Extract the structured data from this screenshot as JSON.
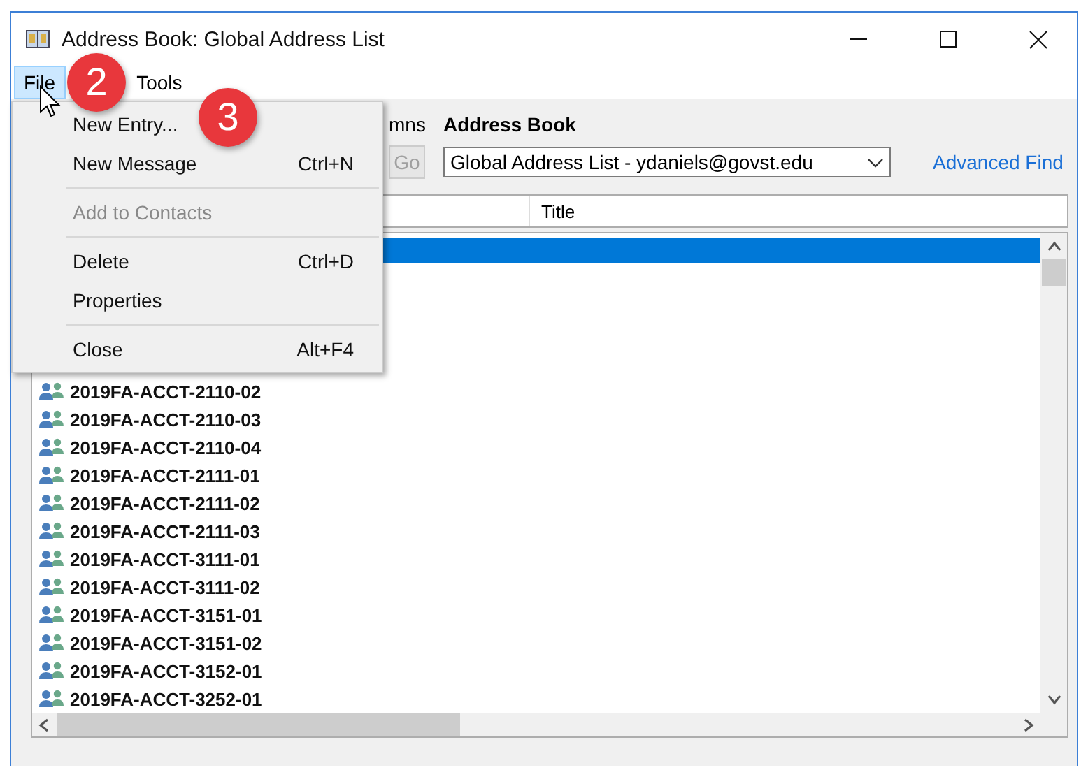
{
  "window": {
    "title": "Address Book: Global Address List"
  },
  "menu_bar": [
    {
      "label": "File",
      "selected": true
    },
    {
      "label": "Tools",
      "selected": false
    }
  ],
  "file_menu": {
    "groups": [
      [
        {
          "label": "New Entry...",
          "disabled": false
        },
        {
          "label": "New Message",
          "shortcut": "Ctrl+N",
          "disabled": false
        }
      ],
      [
        {
          "label": "Add to Contacts",
          "disabled": true
        }
      ],
      [
        {
          "label": "Delete",
          "shortcut": "Ctrl+D",
          "disabled": false
        },
        {
          "label": "Properties",
          "disabled": false
        }
      ],
      [
        {
          "label": "Close",
          "shortcut": "Alt+F4",
          "disabled": false
        }
      ]
    ]
  },
  "search": {
    "columns_label": "mns",
    "go_button": {
      "label": "Go",
      "disabled": true
    }
  },
  "address_book": {
    "label": "Address Book",
    "value": "Global Address List - ydaniels@govst.edu",
    "advanced_find": "Advanced Find"
  },
  "table": {
    "columns": [
      "Title"
    ],
    "rows": [
      {
        "selected": true
      },
      {
        "name": "2019FA-ACCT-2110-02",
        "selected": false
      },
      {
        "name": "2019FA-ACCT-2110-03",
        "selected": false
      },
      {
        "name": "2019FA-ACCT-2110-04",
        "selected": false
      },
      {
        "name": "2019FA-ACCT-2111-01",
        "selected": false
      },
      {
        "name": "2019FA-ACCT-2111-02",
        "selected": false
      },
      {
        "name": "2019FA-ACCT-2111-03",
        "selected": false
      },
      {
        "name": "2019FA-ACCT-3111-01",
        "selected": false
      },
      {
        "name": "2019FA-ACCT-3111-02",
        "selected": false
      },
      {
        "name": "2019FA-ACCT-3151-01",
        "selected": false
      },
      {
        "name": "2019FA-ACCT-3151-02",
        "selected": false
      },
      {
        "name": "2019FA-ACCT-3152-01",
        "selected": false
      },
      {
        "name": "2019FA-ACCT-3252-01",
        "selected": false
      }
    ]
  },
  "step_badges": [
    "2",
    "3"
  ]
}
